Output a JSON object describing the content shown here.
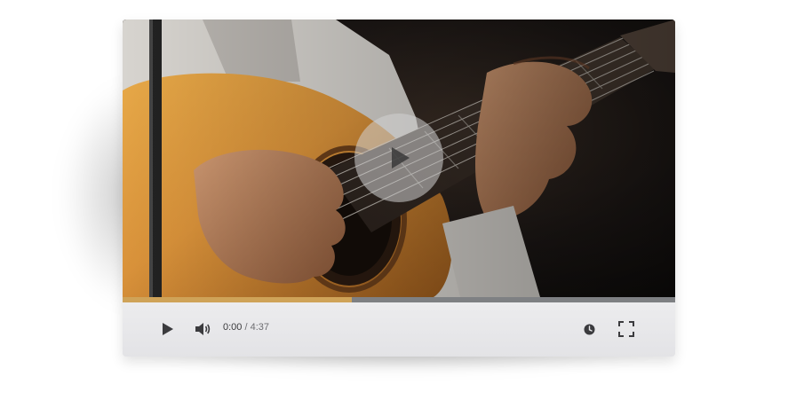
{
  "player": {
    "time": {
      "current": "0:00",
      "separator": " / ",
      "duration": "4:37"
    },
    "progress": {
      "played_fraction": 0.415,
      "played_color": "#cfa358",
      "track_color": "#7e8083"
    },
    "controls": {
      "play_icon": "play-icon",
      "volume_icon": "volume-icon",
      "watch_later_icon": "clock-icon",
      "fullscreen_icon": "fullscreen-icon"
    },
    "overlay": {
      "icon": "play-icon"
    }
  }
}
